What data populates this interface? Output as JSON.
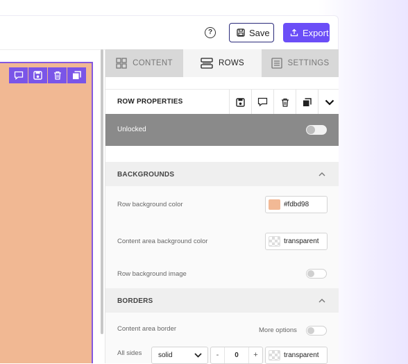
{
  "header": {
    "help_icon": "question-circle-icon",
    "save_label": "Save",
    "export_label": "Export"
  },
  "canvas": {
    "row_color": "#f1b893",
    "selection_color": "#8458e0",
    "toolbar_icons": [
      "comment-icon",
      "save-icon",
      "trash-icon",
      "duplicate-icon"
    ]
  },
  "tabs": [
    {
      "label": "CONTENT",
      "icon": "grid-icon"
    },
    {
      "label": "ROWS",
      "icon": "rows-icon",
      "active": true
    },
    {
      "label": "SETTINGS",
      "icon": "settings-list-icon"
    }
  ],
  "row_properties": {
    "title": "ROW PROPERTIES",
    "icons": [
      "save-icon",
      "comment-icon",
      "trash-icon",
      "duplicate-icon",
      "chevron-down-icon"
    ],
    "lock_label": "Unlocked",
    "locked": false
  },
  "backgrounds": {
    "title": "BACKGROUNDS",
    "row_bg_label": "Row background color",
    "row_bg_value": "#fdbd98",
    "row_bg_swatch": "#f2b995",
    "content_bg_label": "Content area background color",
    "content_bg_value": "transparent",
    "row_bg_image_label": "Row background image",
    "row_bg_image_enabled": false
  },
  "borders": {
    "title": "BORDERS",
    "content_border_label": "Content area border",
    "more_options_label": "More options",
    "more_options_enabled": false,
    "all_sides_label": "All sides",
    "style_value": "solid",
    "width_value": "0",
    "minus": "-",
    "plus": "+",
    "color_value": "transparent"
  },
  "accent": "#6b4ef7"
}
